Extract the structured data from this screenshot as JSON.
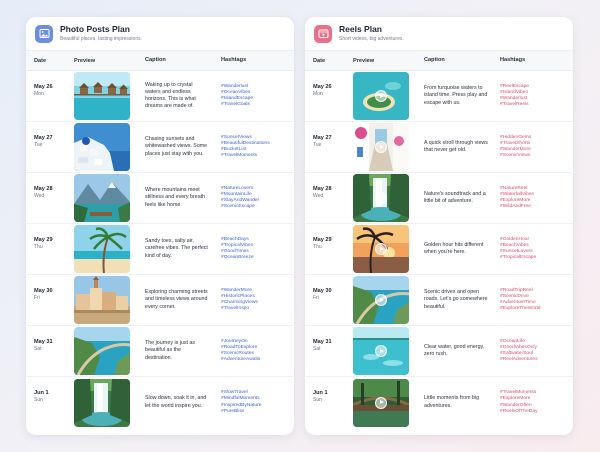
{
  "colors": {
    "photo_accent": "#3f63d3",
    "reels_accent": "#dc4c6b",
    "photo_badge": "#6d8de0",
    "reels_badge": "#e9708a"
  },
  "photo": {
    "title": "Photo Posts Plan",
    "subtitle": "Beautiful places, lasting impressions.",
    "icon": "image-icon",
    "columns": [
      "Date",
      "Preview",
      "Caption",
      "Hashtags"
    ],
    "rows": [
      {
        "date": "May 26",
        "day": "Mon",
        "scene": "overwater-bungalows",
        "caption": "Waking up to crystal waters and endless horizons. This is what dreams are made of.",
        "tags": [
          "#Wanderlust",
          "#OceanVibes",
          "#IslandEscape",
          "#TravelGoals"
        ]
      },
      {
        "date": "May 27",
        "day": "Tue",
        "scene": "santorini",
        "caption": "Chasing sunsets and whitewashed views. Some places just stay with you.",
        "tags": [
          "#SunsetViews",
          "#BeautifulDestinations",
          "#BucketList",
          "#TravelMoments"
        ]
      },
      {
        "date": "May 28",
        "day": "Wed",
        "scene": "mountain-lake",
        "caption": "Where mountains meet stillness and every breath feels like home.",
        "tags": [
          "#NatureLovers",
          "#MountainLife",
          "#StayAndWander",
          "#ScenicEscape"
        ]
      },
      {
        "date": "May 29",
        "day": "Thu",
        "scene": "palm-beach",
        "caption": "Sandy toes, salty air, carefree vibes. The perfect kind of day.",
        "tags": [
          "#BeachDays",
          "#TropicalVibes",
          "#GoodTimes",
          "#OceanBreeze"
        ]
      },
      {
        "date": "May 30",
        "day": "Fri",
        "scene": "old-town",
        "caption": "Exploring charming streets and timeless views around every corner.",
        "tags": [
          "#WanderMore",
          "#HistoricPlaces",
          "#CharmingViews",
          "#TravelInspo"
        ]
      },
      {
        "date": "May 31",
        "day": "Sat",
        "scene": "coast-road",
        "caption": "The journey is just as beautiful as the destination.",
        "tags": [
          "#JourneyOn",
          "#RoadToExplore",
          "#ScenicRoutes",
          "#AdventureAwaits"
        ]
      },
      {
        "date": "Jun 1",
        "day": "Sun",
        "scene": "waterfall",
        "caption": "Slow down, soak it in, and let the world inspire you.",
        "tags": [
          "#SlowTravel",
          "#MindfulMoments",
          "#InspiredByNature",
          "#PureBliss"
        ]
      }
    ]
  },
  "reels": {
    "title": "Reels Plan",
    "subtitle": "Short videos, big adventures.",
    "icon": "video-icon",
    "columns": [
      "Date",
      "Preview",
      "Caption",
      "Hashtags"
    ],
    "rows": [
      {
        "date": "May 26",
        "day": "Mon",
        "scene": "island-aerial",
        "caption": "From turquoise waters to island time. Press play and escape with us.",
        "tags": [
          "#ReelEscape",
          "#IslandVibes",
          "#Wanderlust",
          "#TravelReels"
        ]
      },
      {
        "date": "May 27",
        "day": "Tue",
        "scene": "white-alley",
        "caption": "A quick stroll through views that never get old.",
        "tags": [
          "#HiddenGems",
          "#TravelShorts",
          "#WanderMore",
          "#ScenicViews"
        ]
      },
      {
        "date": "May 28",
        "day": "Wed",
        "scene": "waterfall",
        "caption": "Nature's soundtrack and a little bit of adventure.",
        "tags": [
          "#NatureReel",
          "#WaterfallVibes",
          "#ExploreMore",
          "#WildAndFree"
        ]
      },
      {
        "date": "May 29",
        "day": "Thu",
        "scene": "sunset-palm",
        "caption": "Golden hour hits different when you're here.",
        "tags": [
          "#GoldenHour",
          "#BeachVibes",
          "#SunsetLovers",
          "#TropicalEscape"
        ]
      },
      {
        "date": "May 30",
        "day": "Fri",
        "scene": "coast-road",
        "caption": "Scenic drives and open roads. Let's go somewhere beautiful.",
        "tags": [
          "#RoadTripReel",
          "#ScenicDrive",
          "#AdventureTime",
          "#ExploreTheWorld"
        ]
      },
      {
        "date": "May 31",
        "day": "Sat",
        "scene": "clear-water",
        "caption": "Clear water, good energy, zero rush.",
        "tags": [
          "#OceanLife",
          "#GoodVibesOnly",
          "#SaltwaterSoul",
          "#ReelAdventures"
        ]
      },
      {
        "date": "Jun 1",
        "day": "Sun",
        "scene": "forest-bridge",
        "caption": "Little moments from big adventures.",
        "tags": [
          "#TravelMoments",
          "#ExploreMore",
          "#WanderOften",
          "#ReelsOfTheDay"
        ]
      }
    ]
  }
}
